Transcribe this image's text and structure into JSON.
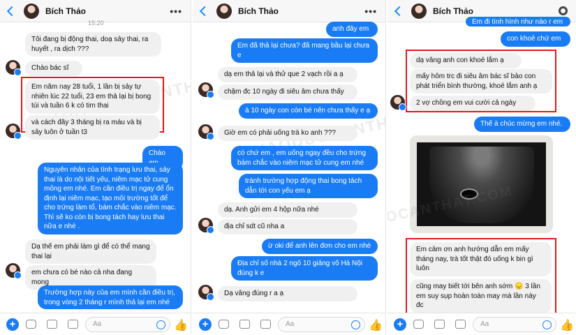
{
  "panels": [
    {
      "header": {
        "name": "Bích Thảo"
      },
      "time": "15:20",
      "messages": [
        "Tôi đang bị động thai, doạ sảy thai, ra huyết , ra dịch ???",
        "Chào bác sĩ",
        "Em năm nay 28 tuổi, 1 lần bị sảy tự nhiên lúc 22 tuổi, 23 em thả lại bị bong túi và tuần 6 k có tim thai",
        "và  cách đây 3 tháng bị ra máu và bị sảy luôn ở tuần t3",
        "Chào em",
        "Nguyên nhân của tình trạng lưu thai, sảy thai là do nội tiết yếu, niêm mạc tử cung mỏng em nhé. Em cần điều trị ngay để ổn định lại niêm mạc, tạo môi trường tốt để cho trứng làm tổ, bám chắc vào niêm mạc. Thì sẽ ko còn bị bong tách hay lưu thai nữa e nhé .",
        "Dạ thế em phải làm gì để có thể mang thai lại",
        "em chưa có bé nào cả nha đang mong",
        "Trường hợp này của em mình cần điều trị, trong vòng 2 tháng r mình thả lại em nhé"
      ],
      "composer": {
        "placeholder": "Aa"
      },
      "watermark": "THAODUOCANTHAT.COM"
    },
    {
      "header": {
        "name": "Bích Thảo"
      },
      "messages": [
        "anh đây em",
        "Em đã thả lại chưa? đã mang bầu lại chưa e",
        "dạ em thả lại và thử que 2 vạch rồi a ạ",
        "chậm đc 10 ngày đi siêu âm chưa thấy",
        "à 10 ngày con còn bé nên chưa thấy e ạ",
        "Giờ em có phải uống trà ko anh ???",
        "có chứ em , em uống ngay đều cho trứng bám chắc vào niêm mạc tử cung em nhé",
        "tránh trường hợp động thai bong tách dẫn tới con yếu em ạ",
        "dạ. Anh gửi em 4 hộp nữa nhé",
        "địa chỉ sdt cũ nha a",
        "ừ oki để anh lên đơn cho em nhé",
        "Địa chỉ số nhà 2 ngõ 10 giảng võ Hà Nội đúng k e",
        "Dạ vâng đúng r a ạ"
      ],
      "composer": {
        "placeholder": "Aa"
      },
      "watermark": "THAODUOCANTHAT.COM"
    },
    {
      "header": {
        "name": "Bích Thảo"
      },
      "messages": [
        "Em đi tình hình như nào r em",
        "con khoẻ chứ em",
        "dạ vâng anh con khoẻ lắm ạ",
        "mấy hôm trc đi siêu âm bác sĩ bảo con phát triển bình thường, khoẻ lắm anh ạ",
        "2 vợ chồng em vui cười cả ngày",
        "Thế à chúc mừng em nhé.",
        "Em cảm ơn anh hướng dẫn em mấy tháng nay, trà tốt thật đó uống k bin gì luôn",
        "cũng may biết tới bên anh sớm 😞 3 lần em suy sụp hoàn toàn may mà lần này đc"
      ],
      "photo": {
        "label": "ultrasound image"
      },
      "composer": {
        "placeholder": "Aa"
      },
      "watermark": "THAODUOCANTHAT.COM"
    }
  ],
  "colors": {
    "accent": "#1a7cf5",
    "highlight": "#e51717",
    "incoming": "#f1f0f0"
  }
}
